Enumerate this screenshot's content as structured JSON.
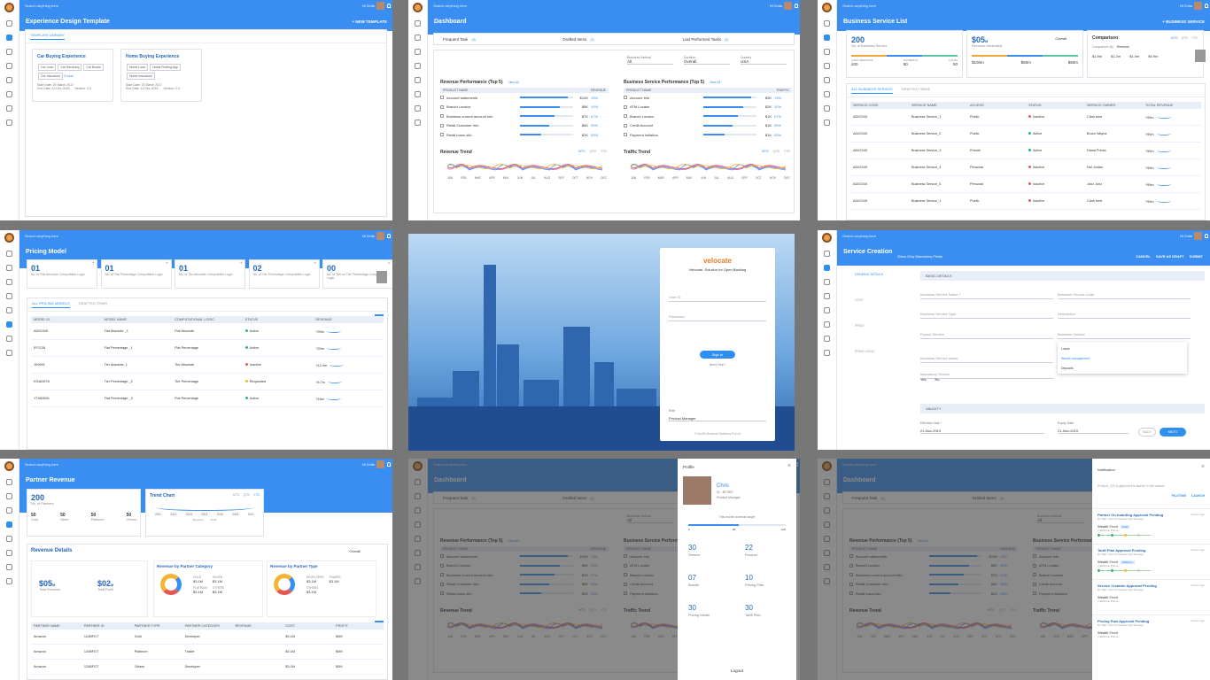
{
  "common": {
    "search_placeholder": "Search anything here",
    "user": "Hi Chris"
  },
  "p1": {
    "title": "Experience Design Template",
    "action": "+ NEW TEMPLATE",
    "tab": "TEMPLATE LIBRARY",
    "cards": [
      {
        "title": "Car Buying Experience",
        "chips": [
          "Car Loan",
          "Car Servicing",
          "Car Books",
          "Car Insurance"
        ],
        "more": "3 more",
        "start": "Start Date: 20 March 2017",
        "end": "End Date: 12 Dec 2018",
        "version": "Version: 2.0"
      },
      {
        "title": "Home Buying Experience",
        "chips": [
          "Home Loan",
          "Home Finding App",
          "Home Insurance"
        ],
        "more": "",
        "start": "Start Date: 20 March 2017",
        "end": "End Date: 12 Dec 2018",
        "version": "Version: 2.0"
      }
    ]
  },
  "p2": {
    "title": "Dashboard",
    "tasks": [
      {
        "label": "Frequent Task",
        "count": "(9)"
      },
      {
        "label": "Drafted Items",
        "count": "(3)"
      },
      {
        "label": "Last Performed Tasks",
        "count": "(3)"
      }
    ],
    "filters": [
      {
        "label": "Business Vertical",
        "value": "All"
      },
      {
        "label": "Duration",
        "value": "Overall"
      },
      {
        "label": "Country",
        "value": "USA"
      }
    ],
    "rev_title": "Revenue Performance (Top 5)",
    "svc_title": "Business Service Performance (Top 5)",
    "view_all": "View All",
    "rev_header": [
      "PRODUCT NAME",
      "REVENUE"
    ],
    "rev_rows": [
      {
        "name": "Account statements",
        "val": "$10K",
        "pct": "13%",
        "fill": 0.9
      },
      {
        "name": "Branch Locator",
        "val": "$8K",
        "pct": "10%",
        "fill": 0.75
      },
      {
        "name": "Business current account info",
        "val": "$7K",
        "pct": "07%",
        "fill": 0.65
      },
      {
        "name": "Retail Customer Info",
        "val": "$6K",
        "pct": "05%",
        "fill": 0.55
      },
      {
        "name": "Retail loans info",
        "val": "$2K",
        "pct": "03%",
        "fill": 0.4
      }
    ],
    "svc_header": [
      "PRODUCT NAME",
      "TRAFFIC"
    ],
    "svc_rows": [
      {
        "name": "Account Info",
        "val": "$3K",
        "pct": "13%",
        "fill": 0.9
      },
      {
        "name": "ATM Locator",
        "val": "$2K",
        "pct": "10%",
        "fill": 0.75
      },
      {
        "name": "Branch Locator",
        "val": "$1K",
        "pct": "07%",
        "fill": 0.65
      },
      {
        "name": "Credit Account",
        "val": "$1K",
        "pct": "05%",
        "fill": 0.55
      },
      {
        "name": "Payment Initiation",
        "val": "$1K",
        "pct": "03%",
        "fill": 0.4
      }
    ],
    "rev_trend": "Revenue Trend",
    "traffic_trend": "Traffic Trend",
    "periods": [
      "MTD",
      "QTD",
      "YTD"
    ],
    "months": [
      "JAN",
      "FEB",
      "MAR",
      "APR",
      "MAY",
      "JUN",
      "JUL",
      "AUG",
      "SEP",
      "OCT",
      "NOV",
      "DEC"
    ]
  },
  "p3": {
    "title": "Business Service List",
    "action": "+ BUSINESS SERVICE",
    "m1": {
      "num": "200",
      "lab": "No. of Business Service",
      "legend": [
        "CARD SERVICES",
        "PAYMENTS",
        "LOANS"
      ],
      "vals": [
        "100",
        "50",
        "50"
      ]
    },
    "m2": {
      "num": "$05",
      "unit": "M",
      "lab": "Revenue Generated",
      "filter": "Overall",
      "vals": [
        "$100m",
        "$50m",
        "$50m"
      ]
    },
    "comparison": {
      "title": "Comparison",
      "periods": [
        "MTD",
        "QTD",
        "YTD"
      ],
      "by": "Comparison By",
      "by_val": "Revenue",
      "vals": [
        "$1.5m",
        "$1.2m",
        "$1.0m",
        "$0.9m"
      ]
    },
    "tabs": [
      "ALL BUSINESS SERVICE",
      "DRAFTED ITEMS"
    ],
    "header": [
      "SERVICE CODE",
      "SERVICE NAME",
      "ACCESS",
      "STATUS",
      "SERVICE OWNER",
      "TOTAL REVENUE"
    ],
    "rows": [
      [
        "AD02345",
        "Business Service_1",
        "Public",
        "Inactive",
        "Clark kent",
        "?99m"
      ],
      [
        "AD02345",
        "Business Service_2",
        "Public",
        "Active",
        "Bruce Wayne",
        "?99m"
      ],
      [
        "AD02345",
        "Business Service_3",
        "Private",
        "Active",
        "Diana Prince",
        "?99m"
      ],
      [
        "AD02345",
        "Business Service_4",
        "Personal",
        "Inactive",
        "Hal Jordan",
        "?99m"
      ],
      [
        "AD02345",
        "Business Service_5",
        "Personal",
        "Inactive",
        "Jonz Jonz",
        "?99m"
      ],
      [
        "AD02345",
        "Business Service_1",
        "Public",
        "Inactive",
        "Clark kent",
        "?99m"
      ]
    ]
  },
  "p4": {
    "title": "Pricing Model",
    "metrics": [
      {
        "n": "01",
        "l": "No. of Flat Absolute Computation Logic"
      },
      {
        "n": "01",
        "l": "No. of Flat Percentage Computation Logic"
      },
      {
        "n": "01",
        "l": "No. of Tier Absolute Computation Logic"
      },
      {
        "n": "02",
        "l": "No. of Tier Percentage Computation Logic"
      },
      {
        "n": "00",
        "l": "No. of Tier on Tier Percentage Computation Logic"
      }
    ],
    "tabs": [
      "ALL PRICING MODELS",
      "DRAFTED ITEMS"
    ],
    "header": [
      "MODEL ID",
      "MODEL NAME",
      "COMPUTATIONAL LOGIC",
      "STATUS",
      "REVENUE"
    ],
    "rows": [
      [
        "AD02345",
        "Flat Absolute _1",
        "Flat Absolute",
        "Active",
        "?99m"
      ],
      [
        "EF1234",
        "Flat Percentage _1",
        "Flat Percentage",
        "Active",
        "?20m"
      ],
      [
        "JK9991",
        "Tier Absolute_1",
        "Tier Absolute",
        "Inactive",
        "?12.4m"
      ],
      [
        "KS463978",
        "Tier Percentage _2",
        "Tier Percentage",
        "Requested",
        "?6.7m"
      ],
      [
        "YT982006",
        "Flat Percentage _3",
        "Flat Percentage",
        "Active",
        "?18m"
      ]
    ]
  },
  "p5": {
    "brand": "velocate",
    "tagline": "Velocate- Solution for Open Banking",
    "user_ph": "User ID",
    "pass_ph": "Password",
    "signin": "Sign In",
    "need_help": "Need Help?",
    "role_label": "Role",
    "role_value": "Product Manager",
    "footer": "© SunFin Business Solutions Pvt Ltd"
  },
  "p6": {
    "title": "Service Creation",
    "toggle": "Show Only Mandatory Fields",
    "actions": [
      "CANCEL",
      "SAVE AS DRAFT",
      "SUBMIT"
    ],
    "steps": [
      "GENERAL DETAILS",
      "COST",
      "PRICE",
      "PRICE LOGIC"
    ],
    "section1": "BASIC DETAILS",
    "section2": "VALIDITY",
    "fields": [
      "Business Service Name *",
      "Business Service Code",
      "Business Service Type",
      "Description",
      "Payout Service",
      "Business Vertical",
      "Business Service owner",
      "Mandatory Service"
    ],
    "dropdown": [
      "Loans",
      "Wealth management",
      "Deposits"
    ],
    "radios": [
      "Yes",
      "No"
    ],
    "eff_label": "Effective Date *",
    "eff_val": "21-Nov-2019",
    "exp_label": "Expiry Date",
    "exp_val": "21-Nov-2019",
    "back": "BACK",
    "next": "NEXT"
  },
  "p7": {
    "title": "Partner Revenue",
    "m1": {
      "num": "200",
      "lab": "No. of Partners",
      "subs": [
        {
          "n": "50",
          "l": "Gold"
        },
        {
          "n": "50",
          "l": "Silver"
        },
        {
          "n": "50",
          "l": "Platinum"
        },
        {
          "n": "50",
          "l": "Others"
        }
      ]
    },
    "trend": {
      "title": "Trend Chart",
      "periods": [
        "MTD",
        "QTD",
        "YTD"
      ],
      "years": [
        "2011",
        "2012",
        "2013",
        "2014",
        "2015",
        "2016",
        "2017"
      ],
      "legend": [
        "Revenue",
        "Profit"
      ]
    },
    "details": "Revenue Details",
    "filter": "Overall",
    "rev": {
      "num": "$05",
      "unit": "M",
      "lab": "Total Revenue"
    },
    "profit": {
      "num": "$02",
      "unit": "M",
      "lab": "Total Profit"
    },
    "cat_title": "Revenue by Partner Category",
    "cat": [
      {
        "l": "GOLD",
        "v": "$3.1M"
      },
      {
        "l": "SILVER",
        "v": "$3.1M"
      },
      {
        "l": "PLATINUM",
        "v": "$3.1M"
      },
      {
        "l": "OTHERS",
        "v": "$3.1M"
      }
    ],
    "type_title": "Revenue by Partner Type",
    "type": [
      {
        "l": "DEVELOPER",
        "v": "$3.1M"
      },
      {
        "l": "TRADER",
        "v": "$3.1M"
      },
      {
        "l": "OTHERS",
        "v": "$3.1M"
      }
    ],
    "header": [
      "PARTNER NAME",
      "PARTNER ID",
      "PARTNER TYPE",
      "PARTNER CATEGORY",
      "REVENUE",
      "COST",
      "PROFIT"
    ],
    "rows": [
      [
        "Amazon",
        "124BFGT",
        "Gold",
        "Developer",
        "",
        "$3.1M",
        "$0M"
      ],
      [
        "Amazon",
        "124BFGT",
        "Platinum",
        "Trader",
        "",
        "$3.1M",
        "$0M"
      ],
      [
        "Amazon",
        "124BFGT",
        "Others",
        "Developer",
        "",
        "$3.1M",
        "$0M"
      ]
    ]
  },
  "p8": {
    "header": "Profile",
    "name": "Chris",
    "id": "ID - BF7897",
    "role": "Product Manager",
    "target_label": "This month revenue target",
    "target_min": "0",
    "target_mid": "50",
    "target_max": "100",
    "target_fill": 0.52,
    "stats": [
      {
        "n": "30",
        "l": "Service"
      },
      {
        "n": "22",
        "l": "Product"
      },
      {
        "n": "07",
        "l": "Bundle"
      },
      {
        "n": "10",
        "l": "Pricing Plan"
      },
      {
        "n": "30",
        "l": "Pricing Model"
      },
      {
        "n": "30",
        "l": "Tariff Plan"
      }
    ],
    "logout": "Logout"
  },
  "p9": {
    "header": "Notification",
    "intro": "Product_123 is approved to launch in the market.",
    "links": [
      "PILOTING",
      "LAUNCH"
    ],
    "items": [
      {
        "title": "Partner On-boarding Approval Pending",
        "by": "By Marc, Partner Relationship Manager",
        "time": "3 hours ago",
        "sub": "Wealth Front",
        "tag": "Gold",
        "sub2": "Traditional Partner"
      },
      {
        "title": "Tariff Plan Approval Pending",
        "by": "By Marc, Partner Relationship Manager",
        "time": "3 hours ago",
        "sub": "Wealth Front",
        "tag": "Platinum",
        "sub2": "Traditional Partner"
      },
      {
        "title": "Service Creation Approval Pending",
        "by": "By Marc, Partner Relationship Manager",
        "time": "3 hours ago",
        "sub": "Wealth Front",
        "tag": "",
        "sub2": "Traditional Partner"
      },
      {
        "title": "Pricing Plan Approval Pending",
        "by": "By Marc, Partner Relationship Manager",
        "time": "3 hours ago",
        "sub": "Wealth Front",
        "tag": "",
        "sub2": "Traditional Partner"
      }
    ]
  },
  "colors": {
    "primary": "#3a8ef2",
    "title": "#2467b8",
    "active": "#35b36b",
    "inactive": "#e45a5a",
    "requested": "#f2b632"
  }
}
